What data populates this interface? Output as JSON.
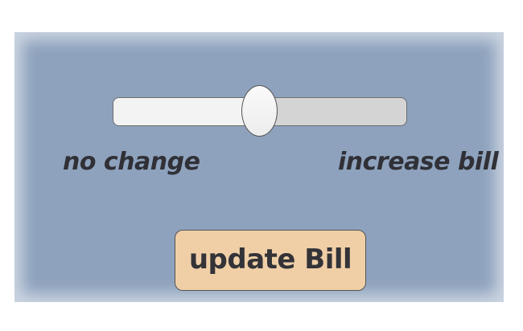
{
  "slider": {
    "value": 0.5,
    "min_label": "no change",
    "max_label": "increase bill"
  },
  "button": {
    "label": "update Bill"
  },
  "colors": {
    "panel_background": "#8ea2bd",
    "button_background": "#f0cfa7",
    "slider_fill": "#f3f3f3",
    "slider_track": "#d4d4d4"
  }
}
